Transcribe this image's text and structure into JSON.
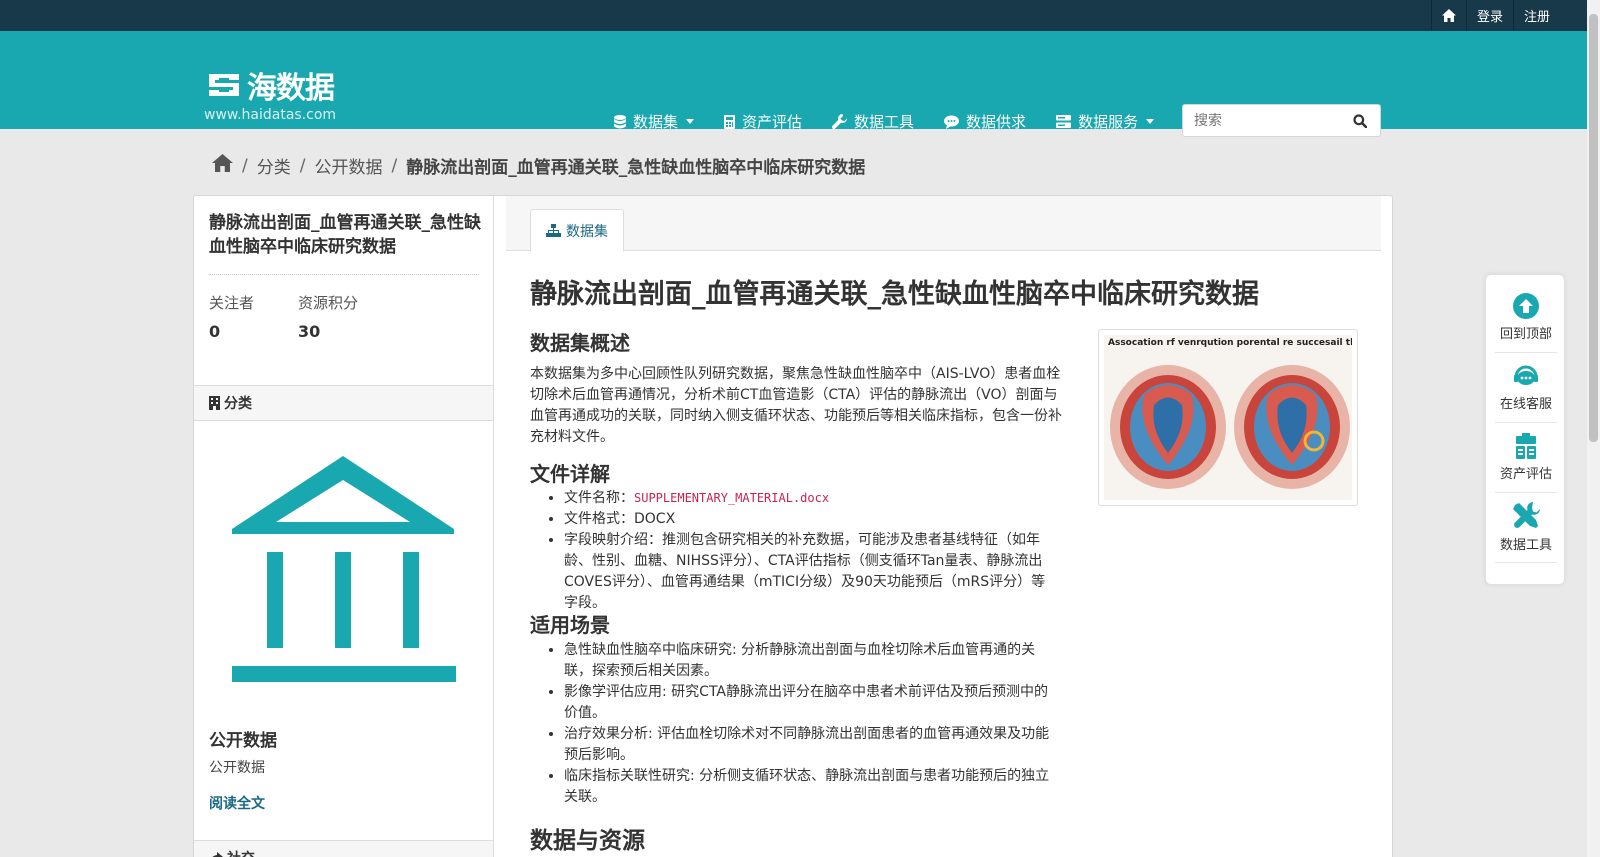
{
  "topbar": {
    "login": "登录",
    "register": "注册"
  },
  "brand": {
    "name": "海数据",
    "url": "www.haidatas.com"
  },
  "nav": {
    "datasets": "数据集",
    "asset_eval": "资产评估",
    "data_tools": "数据工具",
    "data_demand": "数据供求",
    "data_service": "数据服务"
  },
  "search": {
    "placeholder": "搜索"
  },
  "breadcrumb": {
    "category": "分类",
    "public": "公开数据",
    "current": "静脉流出剖面_血管再通关联_急性缺血性脑卒中临床研究数据"
  },
  "sidebar": {
    "title": "静脉流出剖面_血管再通关联_急性缺血性脑卒中临床研究数据",
    "followers_label": "关注者",
    "followers_value": "0",
    "points_label": "资源积分",
    "points_value": "30",
    "category_head": "分类",
    "org_name": "公开数据",
    "org_desc": "公开数据",
    "read_more": "阅读全文",
    "social_head": "社交"
  },
  "content": {
    "tab_label": "数据集",
    "title": "静脉流出剖面_血管再通关联_急性缺血性脑卒中临床研究数据",
    "overview_head": "数据集概述",
    "overview_text": "本数据集为多中心回顾性队列研究数据，聚焦急性缺血性脑卒中（AIS-LVO）患者血栓切除术后血管再通情况，分析术前CT血管造影（CTA）评估的静脉流出（VO）剖面与血管再通成功的关联，同时纳入侧支循环状态、功能预后等相关临床指标，包含一份补充材料文件。",
    "image_caption": "Assocation rf venrqution porental re succesail thornellupprfuslion",
    "files_head": "文件详解",
    "file_name_label": "文件名称：",
    "file_name": "SUPPLEMENTARY_MATERIAL.docx",
    "file_format": "文件格式：DOCX",
    "field_mapping": "字段映射介绍：推测包含研究相关的补充数据，可能涉及患者基线特征（如年龄、性别、血糖、NIHSS评分）、CTA评估指标（侧支循环Tan量表、静脉流出COVES评分）、血管再通结果（mTICI分级）及90天功能预后（mRS评分）等字段。",
    "scenarios_head": "适用场景",
    "scenarios": [
      "急性缺血性脑卒中临床研究: 分析静脉流出剖面与血栓切除术后血管再通的关联，探索预后相关因素。",
      "影像学评估应用: 研究CTA静脉流出评分在脑卒中患者术前评估及预后预测中的价值。",
      "治疗效果分析: 评估血栓切除术对不同静脉流出剖面患者的血管再通效果及功能预后影响。",
      "临床指标关联性研究: 分析侧支循环状态、静脉流出剖面与患者功能预后的独立关联。"
    ],
    "resources_head": "数据与资源"
  },
  "floatbar": {
    "back_top": "回到顶部",
    "online_service": "在线客服",
    "asset_eval": "资产评估",
    "data_tools": "数据工具"
  },
  "colors": {
    "topbar": "#17394a",
    "masthead": "#1aa8b0",
    "accent_link": "#1a6a84",
    "float_icon": "#1aa8b0"
  }
}
